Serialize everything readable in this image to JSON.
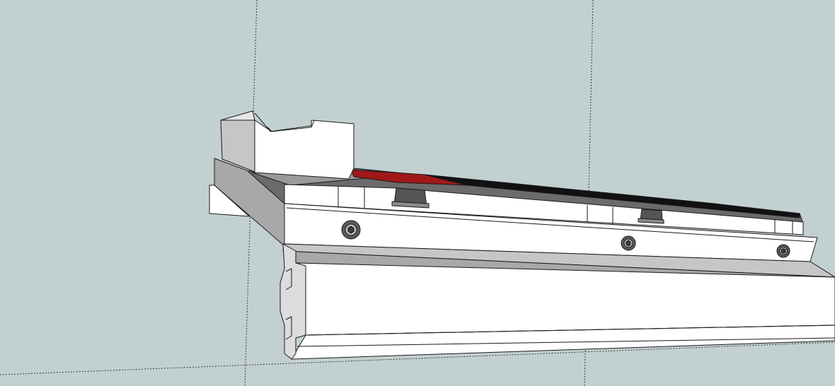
{
  "viewport": {
    "background_color": "#c3d0d1",
    "axis_line_color": "#3a3a3a",
    "axes_style": "dotted"
  },
  "model": {
    "edge_color": "#1a1a1a",
    "face_light": "#ffffff",
    "face_shade": "#c6c6c6",
    "face_dark": "#a8a8a8",
    "accent_red": "#a01818",
    "screw_count": 3,
    "screw_icon": "hex-socket-screw-icon"
  }
}
